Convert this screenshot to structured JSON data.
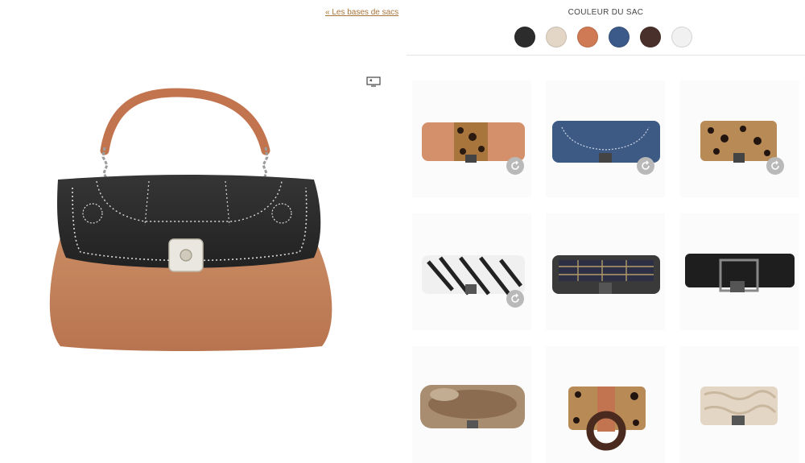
{
  "nav": {
    "back_link": "« Les bases de sacs"
  },
  "preview": {
    "fullscreen_icon": "fullscreen-icon",
    "bag_description": "handbag-preview"
  },
  "color_section": {
    "title": "COULEUR DU SAC",
    "swatches": [
      {
        "name": "black",
        "color": "#2c2c2c"
      },
      {
        "name": "beige",
        "color": "#e3d6c6"
      },
      {
        "name": "terracotta",
        "color": "#d07a55"
      },
      {
        "name": "navy-blue",
        "color": "#3b5a8a"
      },
      {
        "name": "dark-brown",
        "color": "#4a302a"
      },
      {
        "name": "white",
        "color": "#f1f1f1"
      }
    ]
  },
  "flaps": [
    {
      "name": "leopard-stripe-flap",
      "rotate": true
    },
    {
      "name": "navy-embroidered-flap",
      "rotate": true
    },
    {
      "name": "leopard-flap",
      "rotate": true
    },
    {
      "name": "zebra-flap",
      "rotate": true
    },
    {
      "name": "tartan-flap",
      "rotate": false
    },
    {
      "name": "black-buckle-flap",
      "rotate": false
    },
    {
      "name": "fur-flap",
      "rotate": false
    },
    {
      "name": "leopard-ring-flap",
      "rotate": false
    },
    {
      "name": "python-flap",
      "rotate": false
    }
  ],
  "colors": {
    "link": "#a7743c",
    "bag_body": "#c48660",
    "bag_flap": "#2b2b2b"
  }
}
